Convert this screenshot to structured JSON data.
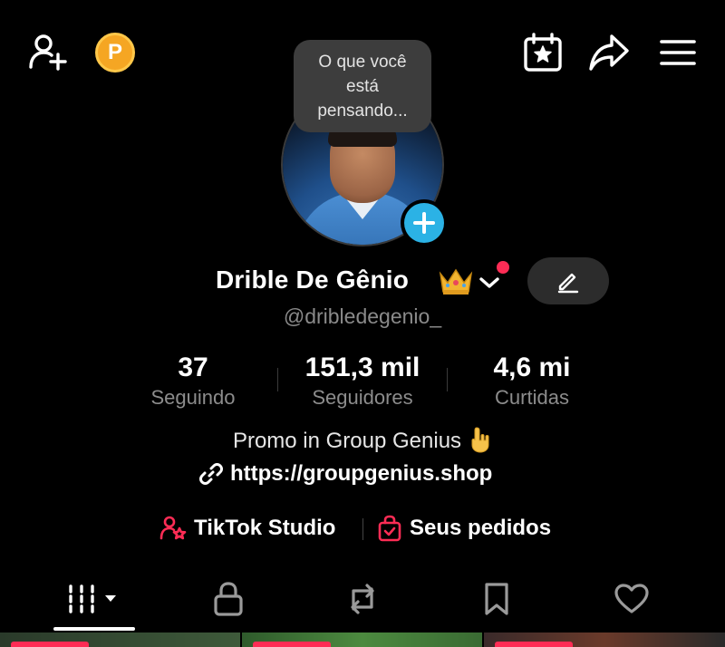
{
  "top_bar": {
    "add_friend_icon": "person-add-icon",
    "coin_label": "P",
    "calendar_icon": "calendar-star-icon",
    "share_icon": "share-arrow-icon",
    "menu_icon": "hamburger-menu-icon"
  },
  "avatar": {
    "tooltip_text": "O que você está pensando...",
    "add_icon": "plus-icon"
  },
  "profile": {
    "name": "Drible De Gênio",
    "name_emoji": "crown",
    "handle": "@dribledegenio_",
    "bio": "Promo in Group Genius",
    "bio_emoji": "pointing-down-hand",
    "link": "https://groupgenius.shop"
  },
  "stats": {
    "following": {
      "value": "37",
      "label": "Seguindo"
    },
    "followers": {
      "value": "151,3 mil",
      "label": "Seguidores"
    },
    "likes": {
      "value": "4,6 mi",
      "label": "Curtidas"
    }
  },
  "shortcuts": {
    "studio": "TikTok Studio",
    "orders": "Seus pedidos"
  },
  "tabs": [
    "videos",
    "private",
    "reposts",
    "saved",
    "liked"
  ],
  "colors": {
    "accent_red": "#fe2c55",
    "accent_blue": "#2bb2e5",
    "coin": "#f5a623",
    "background": "#000000"
  }
}
